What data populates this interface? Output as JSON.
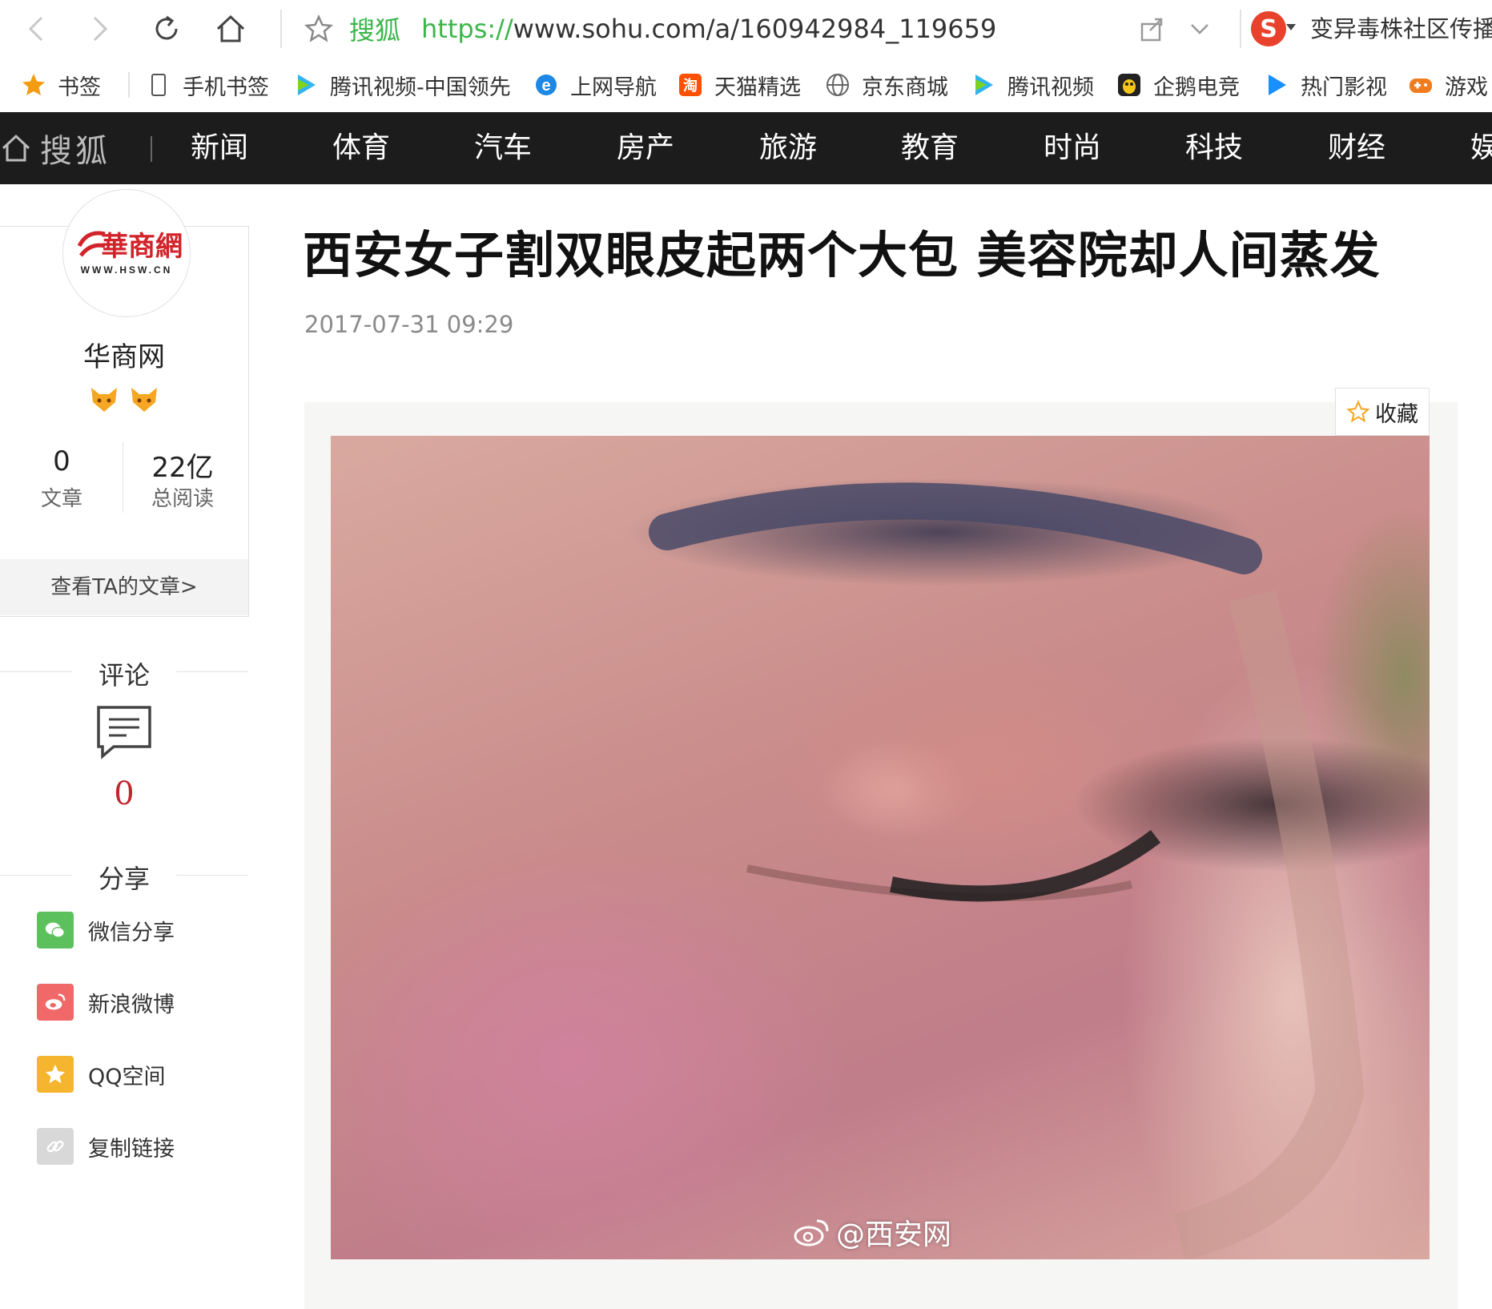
{
  "browser": {
    "site_name": "搜狐",
    "url_protocol": "https://",
    "url_rest": "www.sohu.com/a/160942984_119659",
    "search_text": "变异毒株社区传播"
  },
  "bookmarks": [
    {
      "label": "书签",
      "icon": "star-icon"
    },
    {
      "label": "手机书签",
      "icon": "phone-icon"
    },
    {
      "label": "腾讯视频-中国领先",
      "icon": "tencent-video-icon"
    },
    {
      "label": "上网导航",
      "icon": "ie-icon"
    },
    {
      "label": "天猫精选",
      "icon": "tmall-icon"
    },
    {
      "label": "京东商城",
      "icon": "globe-icon"
    },
    {
      "label": "腾讯视频",
      "icon": "tencent-video-icon"
    },
    {
      "label": "企鹅电竞",
      "icon": "penguin-icon"
    },
    {
      "label": "热门影视",
      "icon": "play-icon"
    },
    {
      "label": "游戏",
      "icon": "game-icon"
    }
  ],
  "sohu_nav": {
    "logo": "搜狐",
    "items": [
      "新闻",
      "体育",
      "汽车",
      "房产",
      "旅游",
      "教育",
      "时尚",
      "科技",
      "财经",
      "娱"
    ]
  },
  "author": {
    "logo_text": "華商網",
    "logo_sub": "WWW.HSW.CN",
    "name": "华商网",
    "articles_count": "0",
    "articles_label": "文章",
    "reads_count": "22亿",
    "reads_label": "总阅读",
    "view_articles": "查看TA的文章>"
  },
  "comments": {
    "title": "评论",
    "count": "0"
  },
  "share": {
    "title": "分享",
    "items": [
      {
        "label": "微信分享",
        "color": "#5cc15c"
      },
      {
        "label": "新浪微博",
        "color": "#f06868"
      },
      {
        "label": "QQ空间",
        "color": "#f5b52e"
      },
      {
        "label": "复制链接",
        "color": "#d8d8d8"
      }
    ]
  },
  "article": {
    "title": "西安女子割双眼皮起两个大包 美容院却人间蒸发",
    "date": "2017-07-31 09:29",
    "collect_label": "收藏",
    "image_watermark": "@西安网"
  },
  "colors": {
    "nav_bg": "#1c1c1c",
    "site_green": "#3bb54a",
    "comment_red": "#c0282e"
  }
}
